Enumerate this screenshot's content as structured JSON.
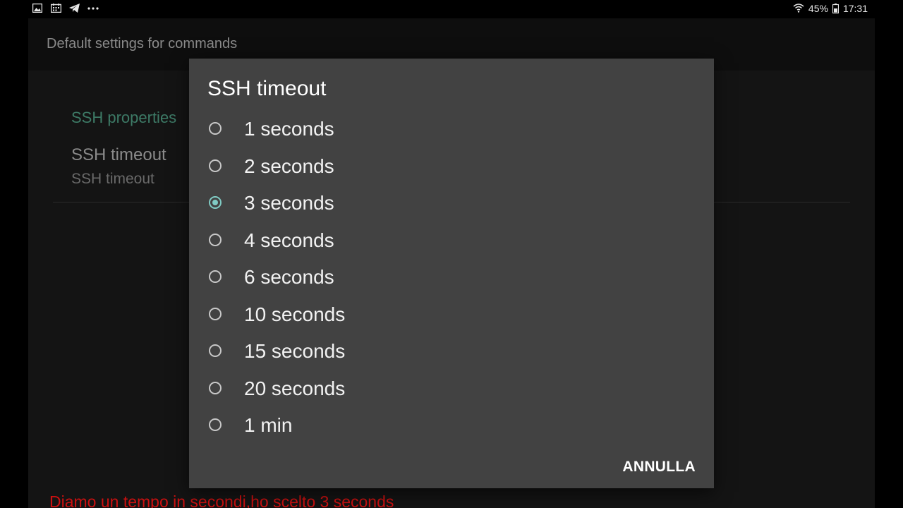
{
  "status_bar": {
    "battery": "45%",
    "time": "17:31",
    "left_icons": [
      "gallery-icon",
      "calendar-icon",
      "telegram-icon",
      "more-dots-icon"
    ],
    "right_icons": [
      "wifi-icon",
      "battery-icon"
    ]
  },
  "appbar": {
    "title": "Default settings for commands"
  },
  "preferences": {
    "section_header": "SSH properties",
    "ssh_timeout_title": "SSH timeout",
    "ssh_timeout_summary": "SSH timeout"
  },
  "dialog": {
    "title": "SSH timeout",
    "options": [
      {
        "label": "1 seconds",
        "checked": false
      },
      {
        "label": "2 seconds",
        "checked": false
      },
      {
        "label": "3 seconds",
        "checked": true
      },
      {
        "label": "4 seconds",
        "checked": false
      },
      {
        "label": "6 seconds",
        "checked": false
      },
      {
        "label": "10 seconds",
        "checked": false
      },
      {
        "label": "15 seconds",
        "checked": false
      },
      {
        "label": "20 seconds",
        "checked": false
      },
      {
        "label": "1 min",
        "checked": false
      }
    ],
    "cancel_label": "ANNULLA"
  },
  "caption": "Diamo un tempo in secondi,ho scelto 3 seconds",
  "colors": {
    "accent": "#80cbc4",
    "dialog_bg": "#424242",
    "section_header": "#3d7a66",
    "caption": "#cc1010"
  }
}
